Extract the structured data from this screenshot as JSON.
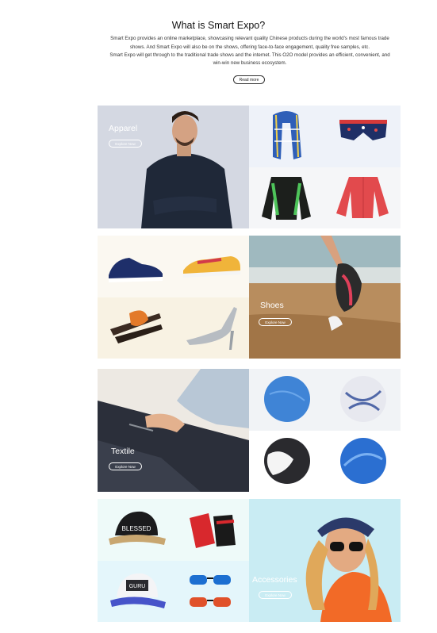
{
  "intro": {
    "title": "What is Smart Expo?",
    "line1": "Smart Expo provides an online marketplace, showcasing relevant quality Chinese products during the world's most famous trade",
    "line2": "shows. And Smart Expo will also be on the shows, offering face-to-face engagement, quality free samples, etc.",
    "line3": "Smart Expo will get through to the traditional trade shows and the internet. This O2O model provides an efficient, convenient, and",
    "line4": "win-win new business ecosystem.",
    "read_more": "Read more"
  },
  "categories": [
    {
      "label": "Apparel",
      "button": "Explore Now"
    },
    {
      "label": "Shoes",
      "button": "Explore Now"
    },
    {
      "label": "Textile",
      "button": "Explore Now"
    },
    {
      "label": "Accessories",
      "button": "Explore Now"
    }
  ],
  "product_text": {
    "cap_text": "BLESSED",
    "cap2_text": "GURU"
  },
  "colors": {
    "apparel_bg": "#d9dde6",
    "light_blue": "#eef3fb",
    "cream": "#faf6ee",
    "sand": "#c8a67a",
    "sky": "#cdeaf0"
  }
}
